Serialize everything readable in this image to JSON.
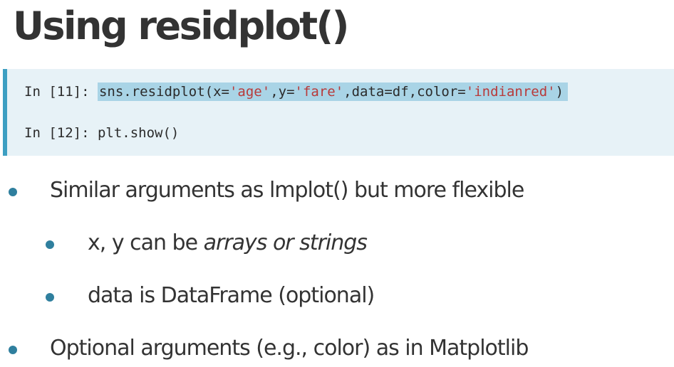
{
  "title": "Using residplot()",
  "code": {
    "line1": {
      "prompt": "In [11]: ",
      "pre": "sns.residplot(x=",
      "s1": "'age'",
      "mid1": ",y=",
      "s2": "'fare'",
      "mid2": ",data=df,color=",
      "s3": "'indianred'",
      "post": ")"
    },
    "line2": {
      "prompt": "In [12]: ",
      "code": "plt.show()"
    }
  },
  "bullets": {
    "b1": "Similar arguments as lmplot() but more flexible",
    "b1_sub1_plain": "x, y can be ",
    "b1_sub1_italic": "arrays or strings",
    "b1_sub2": "data is DataFrame (optional)",
    "b2": "Optional arguments (e.g., color) as in Matplotlib"
  },
  "colors": {
    "accent": "#3d9fc2",
    "code_bg": "#e7f2f7",
    "highlight": "#a9d4e6",
    "string": "#b83a3a",
    "bullet": "#2f7f9e"
  }
}
